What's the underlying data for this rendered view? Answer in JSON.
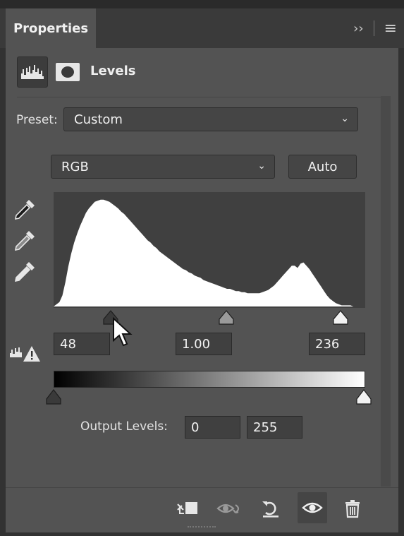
{
  "panel": {
    "tab_title": "Properties",
    "collapse_glyph": "››",
    "menu_glyph": "≡",
    "adjustment_title": "Levels"
  },
  "preset": {
    "label": "Preset:",
    "value": "Custom"
  },
  "channel": {
    "value": "RGB",
    "auto_label": "Auto"
  },
  "input_levels": {
    "black": "48",
    "gamma": "1.00",
    "white": "236"
  },
  "output_levels": {
    "label": "Output Levels:",
    "black": "0",
    "white": "255"
  },
  "histogram": {
    "color": "#ffffff",
    "background": "#404040",
    "profile": [
      0,
      2,
      4,
      10,
      22,
      36,
      48,
      58,
      66,
      73,
      79,
      85,
      89,
      92,
      95,
      96,
      97,
      97,
      96,
      95,
      93,
      91,
      89,
      86,
      84,
      81,
      78,
      75,
      72,
      69,
      66,
      63,
      60,
      58,
      55,
      53,
      50,
      48,
      46,
      44,
      42,
      40,
      38,
      36,
      34,
      33,
      31,
      30,
      28,
      27,
      26,
      24,
      23,
      22,
      21,
      20,
      19,
      18,
      17,
      16,
      16,
      15,
      14,
      14,
      13,
      13,
      12,
      12,
      12,
      12,
      12,
      13,
      14,
      15,
      17,
      19,
      22,
      25,
      28,
      31,
      34,
      37,
      37,
      35,
      39,
      40,
      37,
      34,
      30,
      26,
      22,
      18,
      14,
      10,
      7,
      5,
      3,
      2,
      1,
      1,
      1,
      1,
      0,
      0,
      0,
      0,
      0
    ]
  },
  "icons": {
    "histogram": "levels-histogram-icon",
    "mask": "layer-mask-icon",
    "eyedroppers": [
      "black-point-eyedropper-icon",
      "gray-point-eyedropper-icon",
      "white-point-eyedropper-icon"
    ],
    "clipping_warning": "clipping-warning-icon",
    "footer": [
      "clip-to-layer-icon",
      "view-previous-state-icon",
      "reset-icon",
      "visibility-eye-icon",
      "trash-icon"
    ]
  }
}
